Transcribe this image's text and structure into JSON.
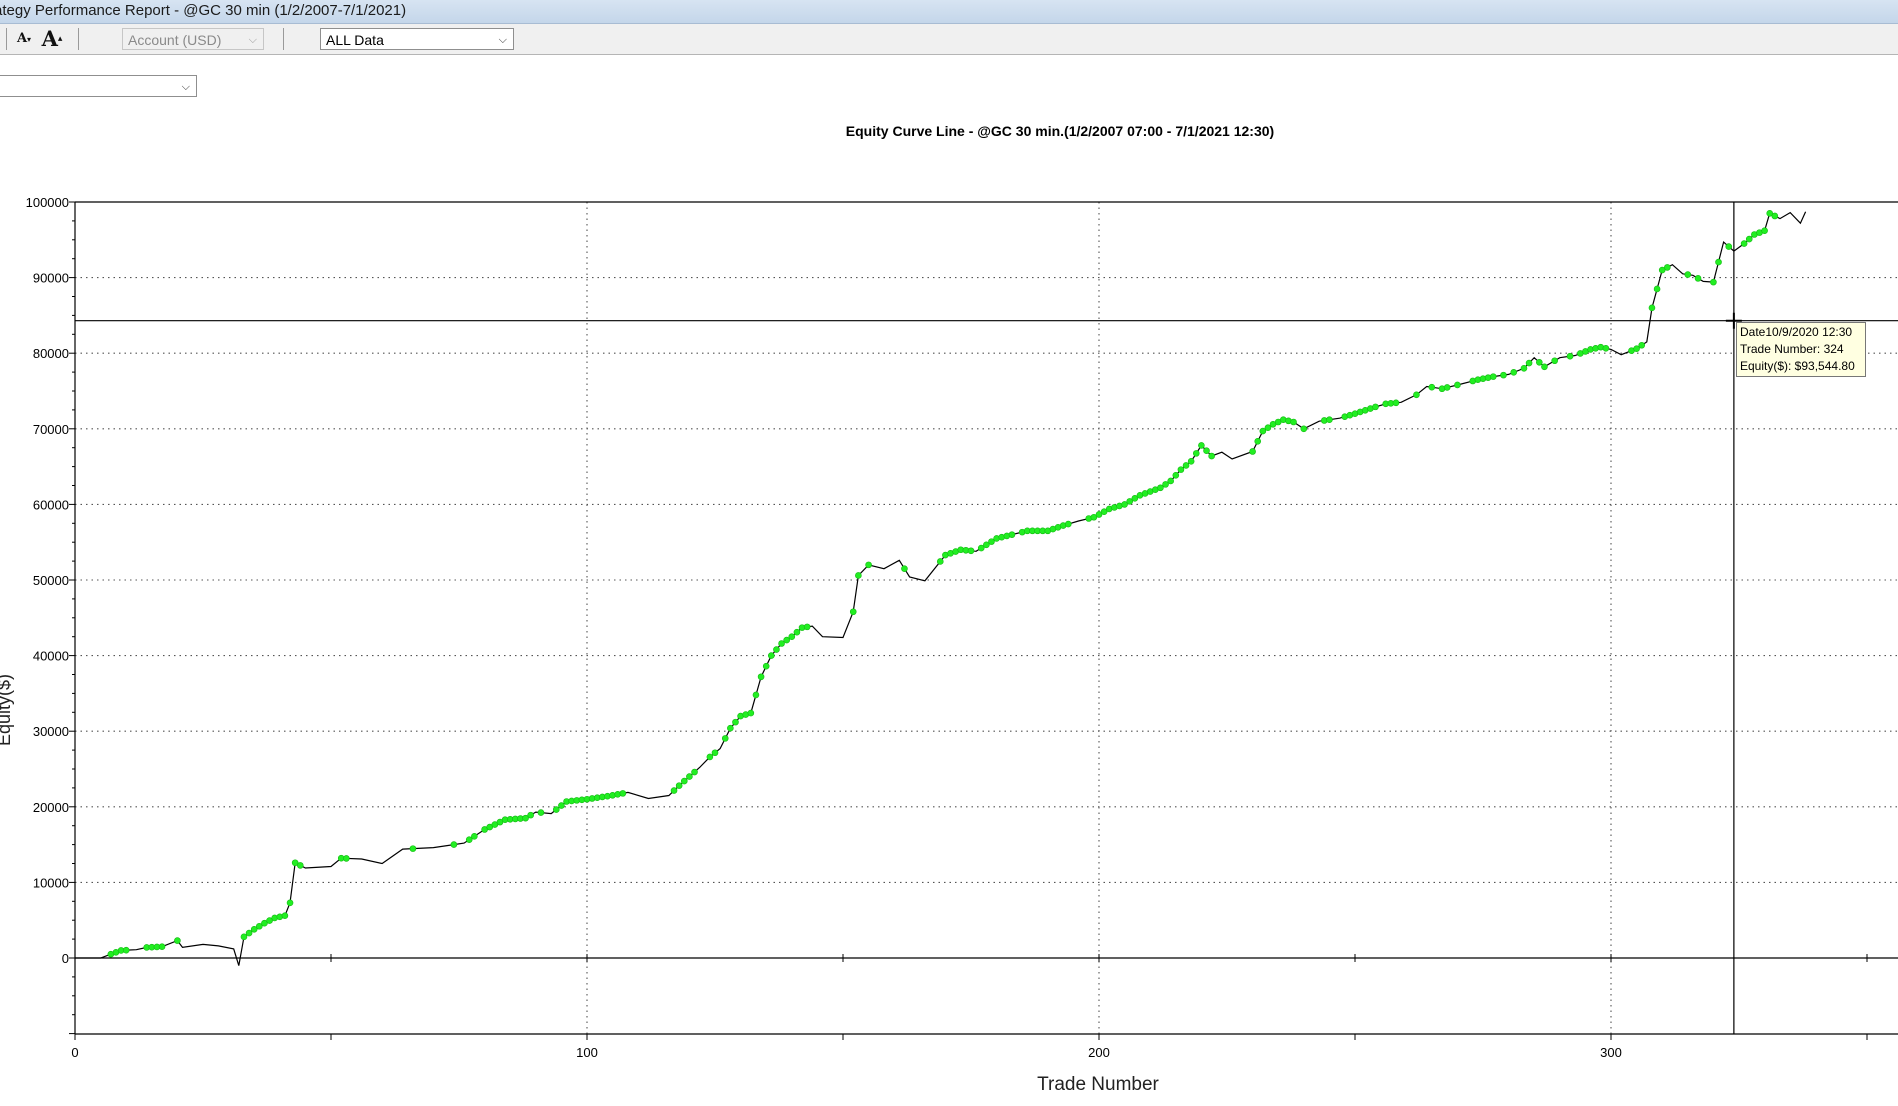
{
  "window": {
    "title": "ategy Performance Report - @GC 30 min (1/2/2007-7/1/2021)"
  },
  "toolbar": {
    "account_select": "Account (USD)",
    "period_select": "ALL Data",
    "decrease_font_icon": "A",
    "increase_font_icon": "A"
  },
  "subbar": {
    "chart_type_select": ""
  },
  "tooltip": {
    "date": "Date10/9/2020 12:30",
    "trade": "Trade Number: 324",
    "equity": "Equity($): $93,544.80"
  },
  "colors": {
    "line": "#000000",
    "marker": "#22ee22",
    "grid": "#555555"
  },
  "chart_data": {
    "type": "line",
    "title": "Equity Curve Line - @GC 30 min.(1/2/2007 07:00 - 7/1/2021 12:30)",
    "xlabel": "Trade Number",
    "ylabel": "Equity($)",
    "xlim": [
      0,
      353
    ],
    "ylim": [
      -10000,
      100000
    ],
    "x_ticks": [
      0,
      100,
      200,
      300
    ],
    "y_ticks": [
      0,
      10000,
      20000,
      30000,
      40000,
      50000,
      60000,
      70000,
      80000,
      90000,
      100000
    ],
    "grid": true,
    "crosshair": {
      "trade": 324,
      "equity": 84300
    },
    "points": [
      [
        0,
        0
      ],
      [
        5,
        0
      ],
      [
        7,
        500
      ],
      [
        9,
        1000
      ],
      [
        12,
        1100
      ],
      [
        14,
        1400
      ],
      [
        17,
        1500
      ],
      [
        20,
        2300
      ],
      [
        21,
        1400
      ],
      [
        25,
        1800
      ],
      [
        28,
        1600
      ],
      [
        31,
        1200
      ],
      [
        32,
        -1000
      ],
      [
        33,
        2800
      ],
      [
        35,
        3800
      ],
      [
        37,
        4600
      ],
      [
        39,
        5300
      ],
      [
        41,
        5600
      ],
      [
        42,
        7300
      ],
      [
        43,
        12600
      ],
      [
        45,
        11900
      ],
      [
        50,
        12100
      ],
      [
        52,
        13200
      ],
      [
        56,
        13100
      ],
      [
        60,
        12500
      ],
      [
        64,
        14400
      ],
      [
        70,
        14600
      ],
      [
        74,
        15000
      ],
      [
        76,
        15200
      ],
      [
        80,
        17000
      ],
      [
        84,
        18300
      ],
      [
        88,
        18500
      ],
      [
        90,
        19300
      ],
      [
        93,
        19100
      ],
      [
        96,
        20700
      ],
      [
        100,
        21000
      ],
      [
        104,
        21400
      ],
      [
        108,
        21900
      ],
      [
        112,
        21100
      ],
      [
        116,
        21500
      ],
      [
        118,
        22800
      ],
      [
        120,
        24000
      ],
      [
        122,
        25200
      ],
      [
        124,
        26600
      ],
      [
        126,
        27700
      ],
      [
        128,
        30400
      ],
      [
        130,
        32000
      ],
      [
        132,
        32400
      ],
      [
        134,
        37200
      ],
      [
        136,
        40000
      ],
      [
        138,
        41600
      ],
      [
        140,
        42500
      ],
      [
        142,
        43700
      ],
      [
        144,
        43900
      ],
      [
        146,
        42500
      ],
      [
        150,
        42400
      ],
      [
        152,
        45800
      ],
      [
        153,
        50600
      ],
      [
        155,
        52000
      ],
      [
        158,
        51500
      ],
      [
        161,
        52600
      ],
      [
        163,
        50400
      ],
      [
        166,
        49900
      ],
      [
        170,
        53300
      ],
      [
        173,
        54000
      ],
      [
        176,
        53800
      ],
      [
        180,
        55500
      ],
      [
        183,
        56000
      ],
      [
        186,
        56500
      ],
      [
        190,
        56500
      ],
      [
        193,
        57200
      ],
      [
        196,
        57800
      ],
      [
        199,
        58300
      ],
      [
        202,
        59400
      ],
      [
        205,
        60000
      ],
      [
        208,
        61200
      ],
      [
        210,
        61700
      ],
      [
        212,
        62200
      ],
      [
        214,
        63100
      ],
      [
        216,
        64600
      ],
      [
        218,
        65700
      ],
      [
        220,
        67800
      ],
      [
        222,
        66400
      ],
      [
        224,
        66900
      ],
      [
        226,
        66000
      ],
      [
        230,
        67000
      ],
      [
        232,
        69700
      ],
      [
        234,
        70600
      ],
      [
        236,
        71200
      ],
      [
        238,
        70900
      ],
      [
        240,
        70000
      ],
      [
        243,
        71000
      ],
      [
        247,
        71400
      ],
      [
        250,
        72000
      ],
      [
        254,
        72900
      ],
      [
        256,
        73300
      ],
      [
        259,
        73500
      ],
      [
        262,
        74500
      ],
      [
        264,
        75600
      ],
      [
        267,
        75300
      ],
      [
        270,
        75800
      ],
      [
        274,
        76500
      ],
      [
        277,
        76900
      ],
      [
        280,
        77200
      ],
      [
        283,
        78000
      ],
      [
        285,
        79400
      ],
      [
        287,
        78200
      ],
      [
        290,
        79400
      ],
      [
        293,
        79700
      ],
      [
        296,
        80500
      ],
      [
        298,
        80800
      ],
      [
        300,
        80500
      ],
      [
        302,
        79800
      ],
      [
        305,
        80600
      ],
      [
        307,
        81500
      ],
      [
        308,
        86000
      ],
      [
        310,
        91000
      ],
      [
        312,
        91700
      ],
      [
        314,
        90500
      ],
      [
        316,
        90300
      ],
      [
        318,
        89500
      ],
      [
        320,
        89400
      ],
      [
        322,
        94700
      ],
      [
        324,
        93500
      ],
      [
        326,
        94500
      ],
      [
        328,
        95700
      ],
      [
        330,
        96200
      ],
      [
        331,
        98500
      ],
      [
        333,
        97800
      ],
      [
        335,
        98600
      ],
      [
        337,
        97200
      ],
      [
        338,
        98700
      ]
    ],
    "marker_trades": [
      7,
      8,
      9,
      10,
      14,
      15,
      16,
      17,
      20,
      33,
      34,
      35,
      36,
      37,
      38,
      39,
      40,
      41,
      42,
      43,
      44,
      52,
      53,
      66,
      74,
      77,
      78,
      80,
      81,
      82,
      83,
      84,
      85,
      86,
      87,
      88,
      89,
      91,
      94,
      95,
      96,
      97,
      98,
      99,
      100,
      101,
      102,
      103,
      104,
      105,
      106,
      107,
      117,
      118,
      119,
      120,
      121,
      124,
      125,
      127,
      128,
      129,
      130,
      131,
      132,
      133,
      134,
      135,
      136,
      137,
      138,
      139,
      140,
      141,
      142,
      143,
      152,
      153,
      155,
      162,
      169,
      170,
      171,
      172,
      173,
      174,
      175,
      177,
      178,
      179,
      180,
      181,
      182,
      183,
      185,
      186,
      187,
      188,
      189,
      190,
      191,
      192,
      193,
      194,
      198,
      199,
      200,
      201,
      202,
      203,
      204,
      205,
      206,
      207,
      208,
      209,
      210,
      211,
      212,
      213,
      214,
      215,
      216,
      217,
      218,
      219,
      220,
      221,
      222,
      230,
      231,
      232,
      233,
      234,
      235,
      236,
      237,
      238,
      240,
      244,
      245,
      248,
      249,
      250,
      251,
      252,
      253,
      254,
      256,
      257,
      258,
      262,
      265,
      267,
      268,
      270,
      273,
      274,
      275,
      276,
      277,
      279,
      281,
      283,
      284,
      286,
      287,
      289,
      292,
      294,
      295,
      296,
      297,
      298,
      299,
      304,
      305,
      306,
      308,
      309,
      310,
      311,
      315,
      317,
      320,
      321,
      323,
      326,
      327,
      328,
      329,
      330,
      331,
      332
    ]
  }
}
